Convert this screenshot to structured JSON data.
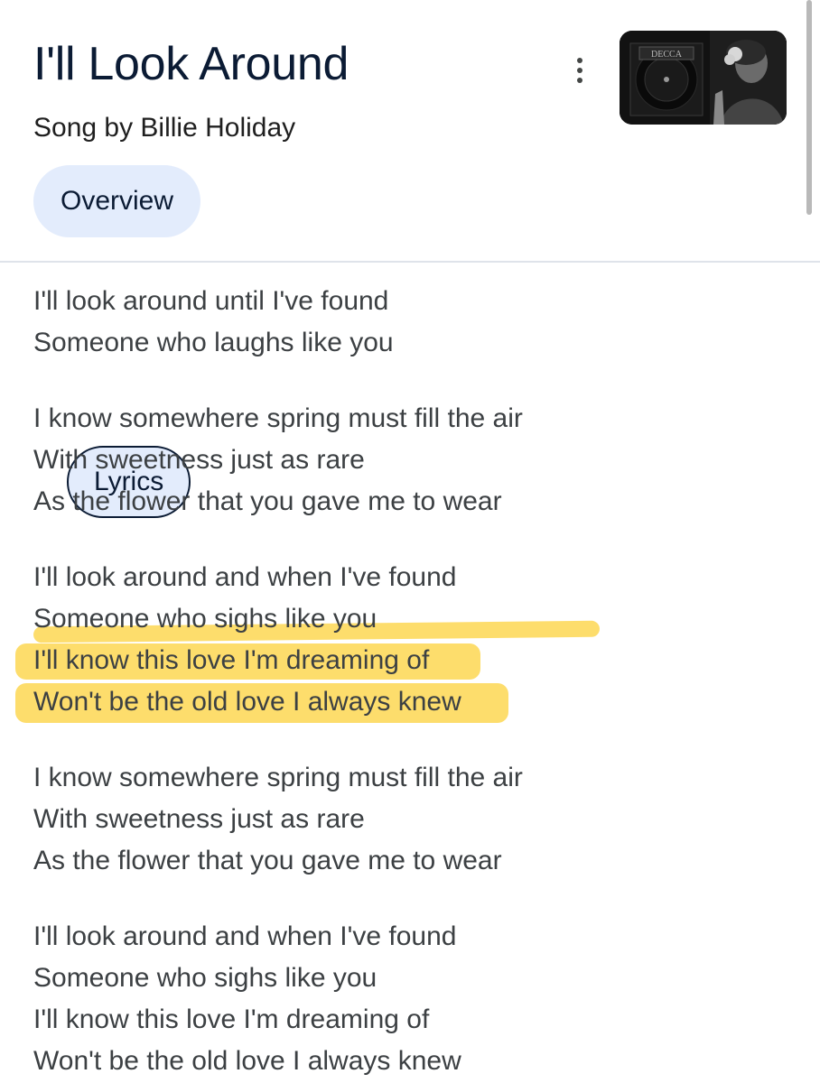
{
  "song": {
    "title": "I'll Look Around",
    "subtitle": "Song by Billie Holiday"
  },
  "tabs": [
    {
      "label": "Overview",
      "selected": false
    },
    {
      "label": "Lyrics",
      "selected": true
    }
  ],
  "thumbnail": {
    "label_text": "DECCA",
    "icon": "album-art-image"
  },
  "more_icon": "more-vert-icon",
  "highlight_color": "#fdd95c",
  "lyrics": {
    "stanzas": [
      {
        "lines": [
          "I'll look around until I've found",
          "Someone who laughs like you"
        ]
      },
      {
        "lines": [
          "I know somewhere spring must fill the air",
          "With sweetness just as rare",
          "As the flower that you gave me to wear"
        ]
      },
      {
        "lines": [
          "I'll look around and when I've found",
          "Someone who sighs like you",
          "I'll know this love I'm dreaming of",
          "Won't be the old love I always knew"
        ]
      },
      {
        "lines": [
          "I know somewhere spring must fill the air",
          "With sweetness just as rare",
          "As the flower that you gave me to wear"
        ]
      },
      {
        "lines": [
          "I'll look around and when I've found",
          "Someone who sighs like you",
          "I'll know this love I'm dreaming of",
          "Won't be the old love I always knew"
        ]
      }
    ]
  }
}
